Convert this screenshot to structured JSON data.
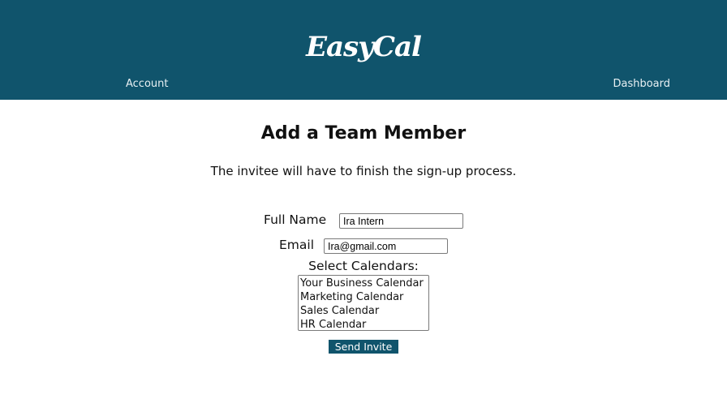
{
  "header": {
    "logo": "EasyCal",
    "nav": {
      "account": "Account",
      "dashboard": "Dashboard"
    }
  },
  "colors": {
    "brand": "#10546c",
    "background": "#ffffff"
  },
  "main": {
    "title": "Add a Team Member",
    "subtitle": "The invitee will have to finish the sign-up process.",
    "form": {
      "full_name_label": "Full Name",
      "full_name_value": "Ira Intern",
      "email_label": "Email",
      "email_value": "Ira@gmail.com",
      "calendars_label": "Select Calendars:",
      "calendars": [
        "Your Business Calendar",
        "Marketing Calendar",
        "Sales Calendar",
        "HR Calendar"
      ],
      "submit_label": "Send Invite"
    }
  }
}
